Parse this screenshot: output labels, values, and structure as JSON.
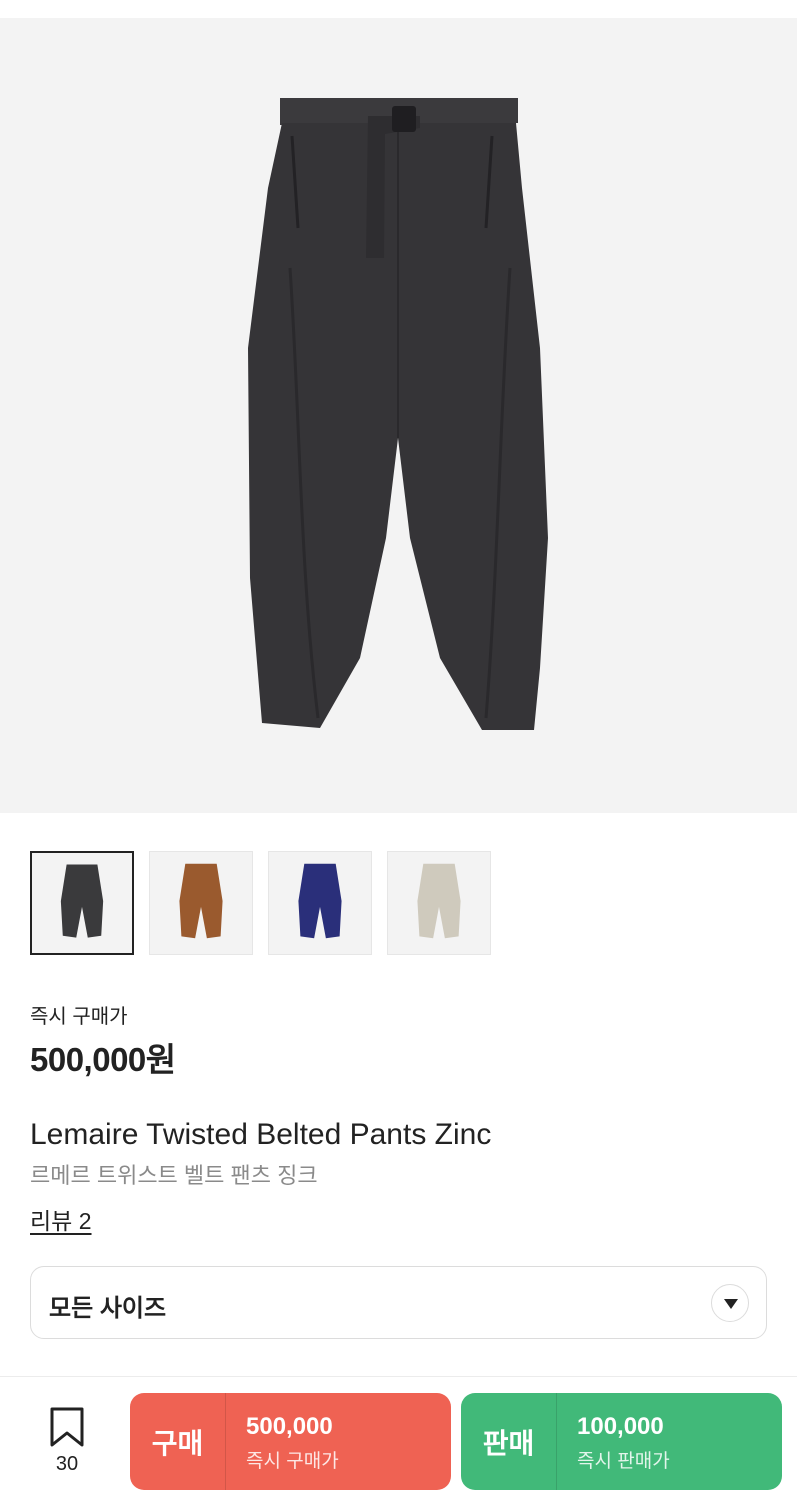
{
  "product": {
    "image_alt": "product-photo-pants",
    "thumbnails": [
      {
        "color": "#3a3a3c",
        "selected": true
      },
      {
        "color": "#9a5a2e",
        "selected": false
      },
      {
        "color": "#2a2f7a",
        "selected": false
      },
      {
        "color": "#cfcabd",
        "selected": false
      }
    ],
    "price_label": "즉시 구매가",
    "price": "500,000원",
    "title_en": "Lemaire Twisted Belted Pants Zinc",
    "title_ko": "르메르 트위스트 벨트 팬츠 징크",
    "review_link": "리뷰 2"
  },
  "size_select": {
    "label": "모든 사이즈",
    "icon": "chevron-down-icon"
  },
  "bottom_bar": {
    "bookmark_count": "30",
    "buy": {
      "label": "구매",
      "amount": "500,000",
      "sub": "즉시 구매가",
      "color": "#ef6253"
    },
    "sell": {
      "label": "판매",
      "amount": "100,000",
      "sub": "즉시 판매가",
      "color": "#41b979"
    }
  }
}
